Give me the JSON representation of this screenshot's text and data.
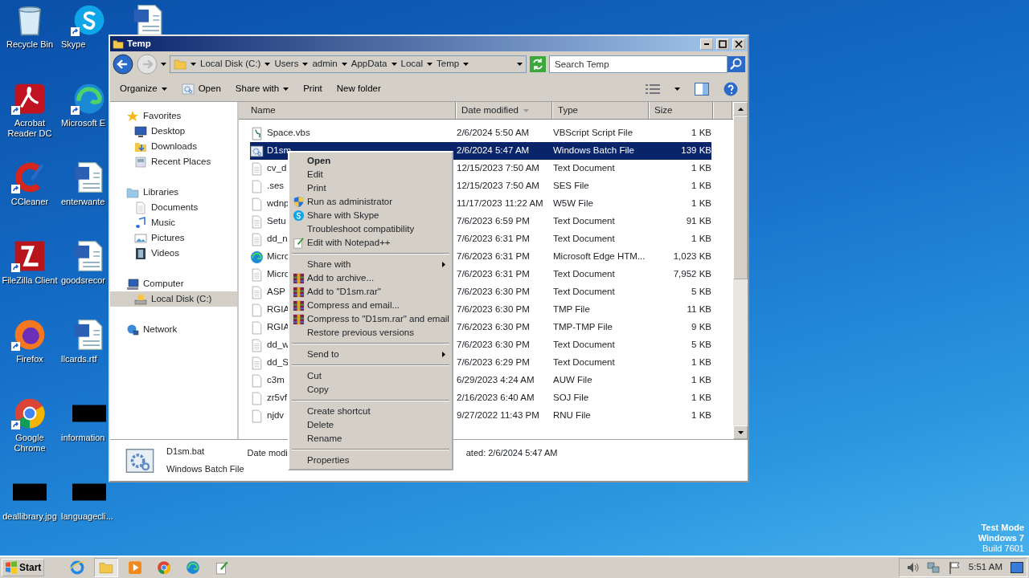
{
  "desktop_icons": [
    {
      "label": "Recycle Bin",
      "kind": "recycle",
      "shortcut": false
    },
    {
      "label": "Acrobat Reader DC",
      "kind": "acrobat",
      "shortcut": true
    },
    {
      "label": "CCleaner",
      "kind": "ccleaner",
      "shortcut": true
    },
    {
      "label": "FileZilla Client",
      "kind": "filezilla",
      "shortcut": true
    },
    {
      "label": "Firefox",
      "kind": "firefox",
      "shortcut": true
    },
    {
      "label": "Google Chrome",
      "kind": "chrome",
      "shortcut": true
    },
    {
      "label": "deallibrary.jpg",
      "kind": "redacted",
      "shortcut": false
    },
    {
      "label": "Skype",
      "kind": "skype",
      "shortcut": true
    },
    {
      "label": "Microsoft E",
      "kind": "edge",
      "shortcut": true
    },
    {
      "label": "enterwante",
      "kind": "word",
      "shortcut": false
    },
    {
      "label": "goodsrecor",
      "kind": "word",
      "shortcut": false
    },
    {
      "label": "llcards.rtf",
      "kind": "word",
      "shortcut": false
    },
    {
      "label": "information",
      "kind": "redacted",
      "shortcut": false
    },
    {
      "label": "languagecli...",
      "kind": "redacted",
      "shortcut": false
    },
    {
      "kind": "word",
      "shortcut": false
    }
  ],
  "window": {
    "title": "Temp",
    "breadcrumb": [
      "Local Disk (C:)",
      "Users",
      "admin",
      "AppData",
      "Local",
      "Temp"
    ],
    "search": {
      "placeholder": "Search Temp"
    },
    "toolbar": [
      {
        "label": "Organize",
        "kind": "menu"
      },
      {
        "label": "Open",
        "kind": "icon"
      },
      {
        "label": "Share with",
        "kind": "menu"
      },
      {
        "label": "Print",
        "kind": "plain"
      },
      {
        "label": "New folder",
        "kind": "plain"
      }
    ],
    "nav": [
      {
        "label": "Favorites",
        "kind": "star",
        "selected": false,
        "children": [
          {
            "label": "Desktop",
            "kind": "monitor",
            "selected": false
          },
          {
            "label": "Downloads",
            "kind": "download",
            "selected": false
          },
          {
            "label": "Recent Places",
            "kind": "recent",
            "selected": false
          }
        ]
      },
      {
        "label": "Libraries",
        "kind": "library",
        "selected": false,
        "children": [
          {
            "label": "Documents",
            "kind": "doc",
            "selected": false
          },
          {
            "label": "Music",
            "kind": "music",
            "selected": false
          },
          {
            "label": "Pictures",
            "kind": "pictures",
            "selected": false
          },
          {
            "label": "Videos",
            "kind": "video",
            "selected": false
          }
        ]
      },
      {
        "label": "Computer",
        "kind": "computer",
        "selected": false,
        "children": [
          {
            "label": "Local Disk (C:)",
            "kind": "drive",
            "selected": true
          }
        ]
      },
      {
        "label": "Network",
        "kind": "network",
        "selected": false
      }
    ],
    "columns": [
      {
        "label": "Name",
        "sorted": false
      },
      {
        "label": "Date modified",
        "sorted": true
      },
      {
        "label": "Type",
        "sorted": false
      },
      {
        "label": "Size",
        "sorted": false
      }
    ],
    "rows": [
      {
        "name": "Space.vbs",
        "kind": "script",
        "date": "2/6/2024 5:50 AM",
        "type": "VBScript Script File",
        "size": "1 KB",
        "selected": false
      },
      {
        "name": "D1sm",
        "kind": "batch",
        "date": "2/6/2024 5:47 AM",
        "type": "Windows Batch File",
        "size": "139 KB",
        "selected": true
      },
      {
        "name": "cv_d",
        "kind": "doc",
        "date": "12/15/2023 7:50 AM",
        "type": "Text Document",
        "size": "1 KB",
        "selected": false
      },
      {
        "name": ".ses",
        "kind": "blank",
        "date": "12/15/2023 7:50 AM",
        "type": "SES File",
        "size": "1 KB",
        "selected": false
      },
      {
        "name": "wdnp",
        "kind": "blank",
        "date": "11/17/2023 11:22 AM",
        "type": "W5W File",
        "size": "1 KB",
        "selected": false
      },
      {
        "name": "Setu",
        "kind": "doc",
        "date": "7/6/2023 6:59 PM",
        "type": "Text Document",
        "size": "91 KB",
        "selected": false
      },
      {
        "name": "dd_n",
        "kind": "doc",
        "date": "7/6/2023 6:31 PM",
        "type": "Text Document",
        "size": "1 KB",
        "selected": false
      },
      {
        "name": "Micro",
        "kind": "edge",
        "date": "7/6/2023 6:31 PM",
        "type": "Microsoft Edge HTM...",
        "size": "1,023 KB",
        "selected": false
      },
      {
        "name": "Micro",
        "kind": "doc",
        "date": "7/6/2023 6:31 PM",
        "type": "Text Document",
        "size": "7,952 KB",
        "selected": false
      },
      {
        "name": "ASP",
        "kind": "doc",
        "date": "7/6/2023 6:30 PM",
        "type": "Text Document",
        "size": "5 KB",
        "selected": false
      },
      {
        "name": "RGIA",
        "kind": "blank",
        "date": "7/6/2023 6:30 PM",
        "type": "TMP File",
        "size": "11 KB",
        "selected": false
      },
      {
        "name": "RGIA",
        "kind": "blank",
        "date": "7/6/2023 6:30 PM",
        "type": "TMP-TMP File",
        "size": "9 KB",
        "selected": false
      },
      {
        "name": "dd_w",
        "kind": "doc",
        "date": "7/6/2023 6:30 PM",
        "type": "Text Document",
        "size": "5 KB",
        "selected": false
      },
      {
        "name": "dd_S",
        "kind": "doc",
        "date": "7/6/2023 6:29 PM",
        "type": "Text Document",
        "size": "1 KB",
        "selected": false
      },
      {
        "name": "c3m",
        "kind": "blank",
        "date": "6/29/2023 4:24 AM",
        "type": "AUW File",
        "size": "1 KB",
        "selected": false
      },
      {
        "name": "zr5vf",
        "kind": "blank",
        "date": "2/16/2023 6:40 AM",
        "type": "SOJ File",
        "size": "1 KB",
        "selected": false
      },
      {
        "name": "njdv",
        "kind": "blank",
        "date": "9/27/2022 11:43 PM",
        "type": "RNU File",
        "size": "1 KB",
        "selected": false
      }
    ],
    "details": {
      "name": "D1sm.bat",
      "type": "Windows Batch File",
      "field_1": "Date modi",
      "field_2": "ated: 2/6/2024 5:47 AM"
    }
  },
  "context_menu": [
    [
      {
        "label": "Open",
        "default": true
      },
      {
        "label": "Edit"
      },
      {
        "label": "Print"
      },
      {
        "label": "Run as administrator",
        "kind": "shield"
      },
      {
        "label": "Share with Skype",
        "kind": "skype"
      },
      {
        "label": "Troubleshoot compatibility"
      },
      {
        "label": "Edit with Notepad++",
        "kind": "notepad"
      }
    ],
    [
      {
        "label": "Share with",
        "submenu": true
      },
      {
        "label": "Add to archive...",
        "kind": "rar"
      },
      {
        "label": "Add to \"D1sm.rar\"",
        "kind": "rar"
      },
      {
        "label": "Compress and email...",
        "kind": "rar"
      },
      {
        "label": "Compress to \"D1sm.rar\" and email",
        "kind": "rar"
      },
      {
        "label": "Restore previous versions"
      }
    ],
    [
      {
        "label": "Send to",
        "submenu": true
      }
    ],
    [
      {
        "label": "Cut"
      },
      {
        "label": "Copy"
      }
    ],
    [
      {
        "label": "Create shortcut"
      },
      {
        "label": "Delete"
      },
      {
        "label": "Rename"
      }
    ],
    [
      {
        "label": "Properties"
      }
    ]
  ],
  "taskbar": {
    "start": "Start",
    "apps": [
      {
        "kind": "ie",
        "selected": false
      },
      {
        "kind": "folder",
        "selected": true
      },
      {
        "kind": "media",
        "selected": false
      },
      {
        "kind": "chrome",
        "selected": false
      },
      {
        "kind": "edge",
        "selected": false
      },
      {
        "kind": "notepad",
        "selected": false
      }
    ],
    "clock": "5:51 AM"
  },
  "os_notice": [
    "Test Mode",
    "Windows 7",
    "Build 7601"
  ]
}
